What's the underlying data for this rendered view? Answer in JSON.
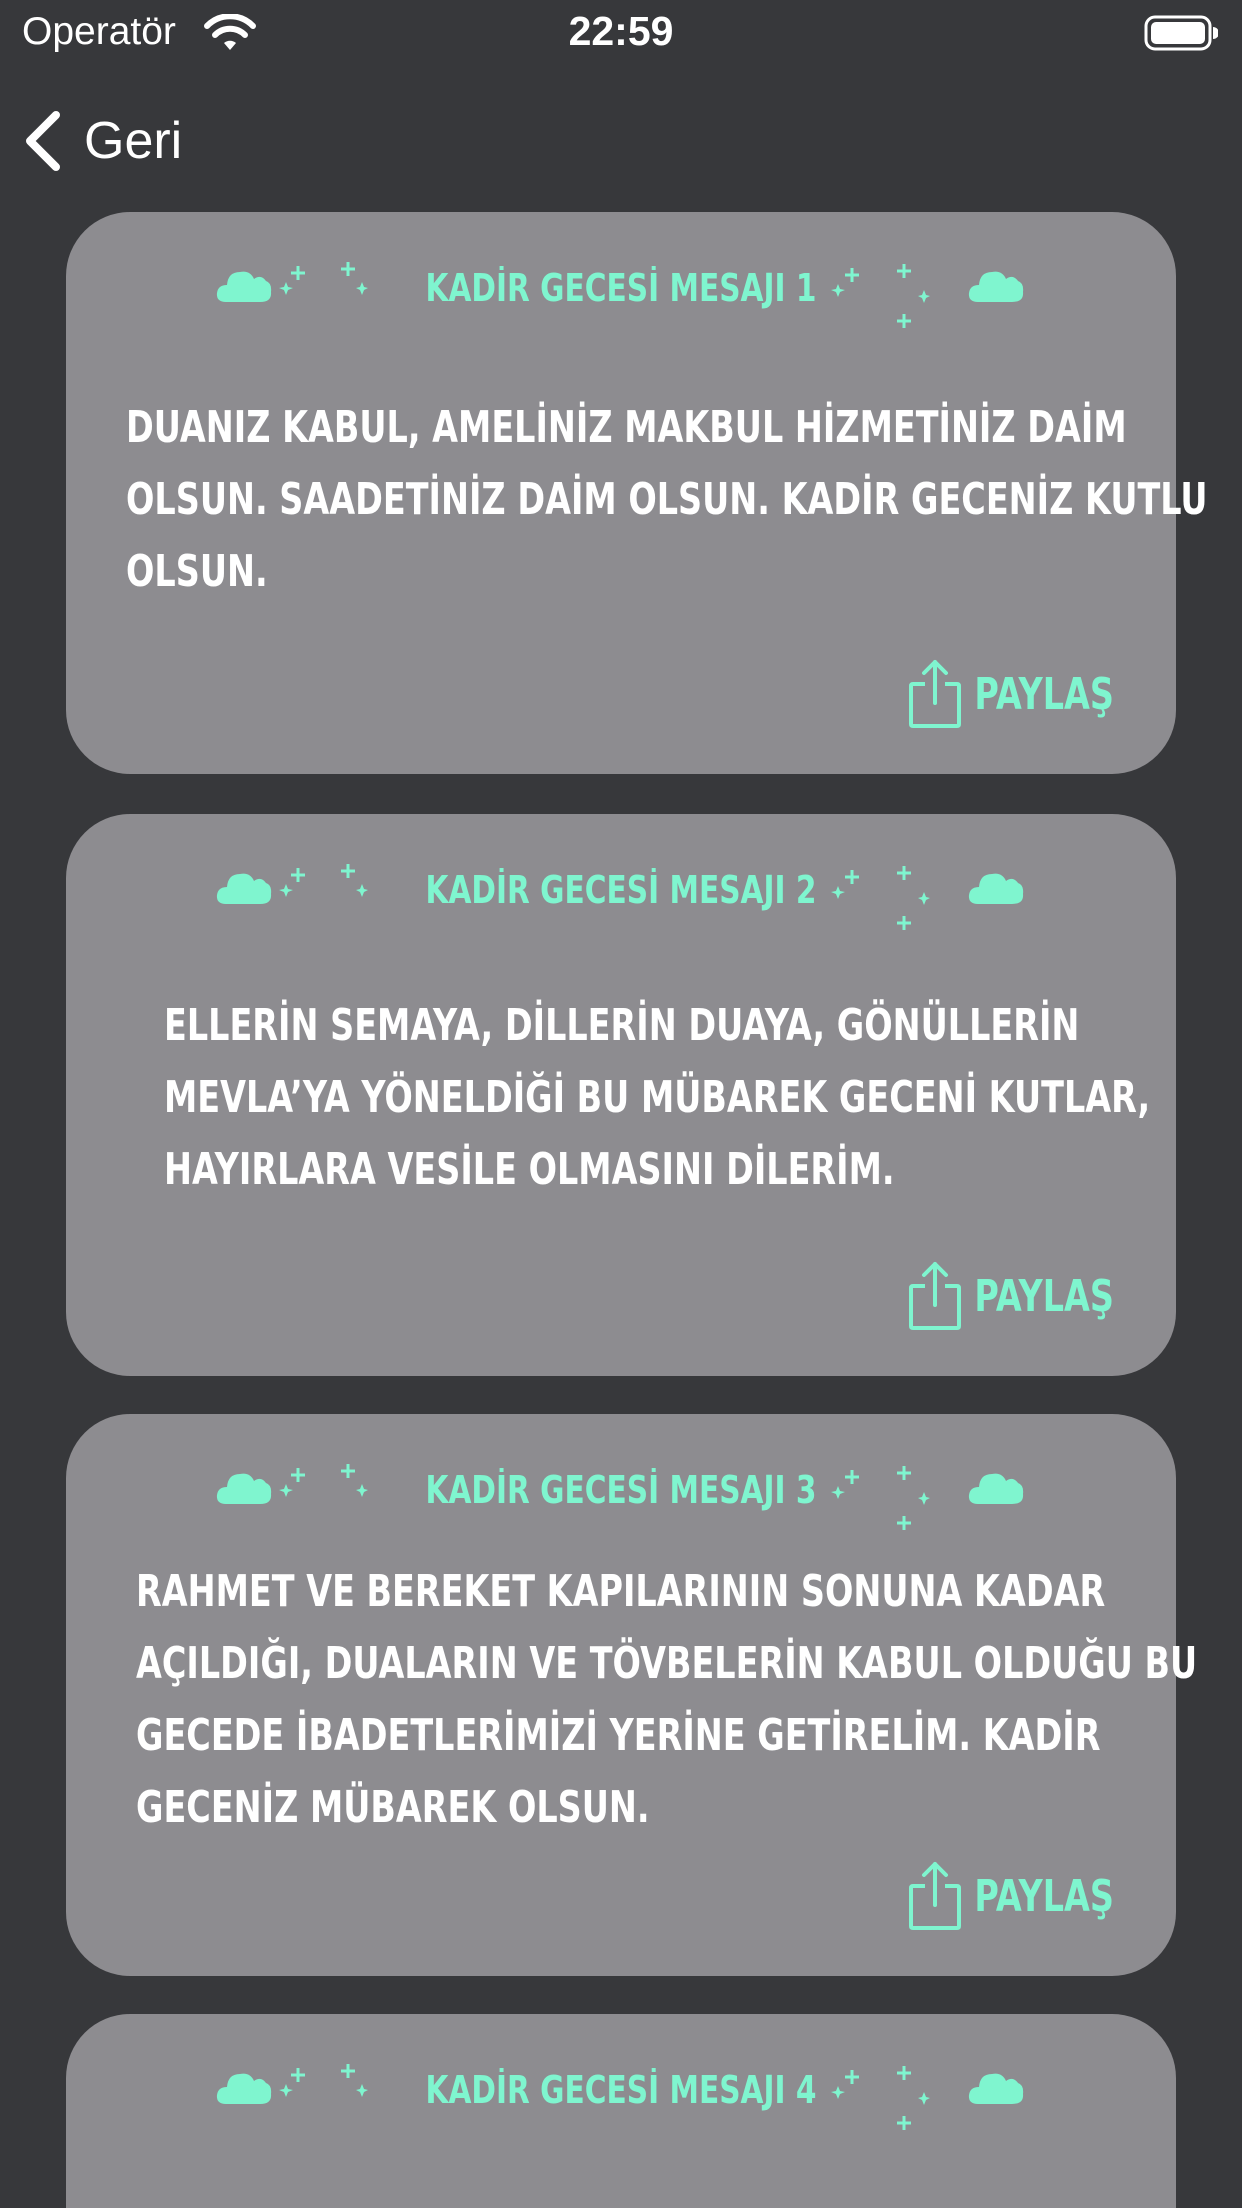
{
  "status_bar": {
    "carrier": "Operatör",
    "time": "22:59"
  },
  "navigation": {
    "back_label": "Geri"
  },
  "icons": {
    "back": "chevron-left-icon",
    "share": "share-icon",
    "wifi": "wifi-icon",
    "battery": "battery-icon",
    "decoration": "cloud-moon-stars-icon"
  },
  "colors": {
    "background": "#37383b",
    "card": "#8d8c90",
    "accent": "#7ff5cf",
    "text": "#ffffff"
  },
  "cards": [
    {
      "title": "KADİR GECESİ MESAJI 1",
      "lines": [
        "DUANIZ KABUL, AMELİNİZ MAKBUL HİZMETİNİZ DAİM",
        "OLSUN. SAADETİNİZ DAİM OLSUN. KADİR GECENİZ KUTLU",
        "OLSUN."
      ],
      "share_label": "PAYLAŞ"
    },
    {
      "title": "KADİR GECESİ MESAJI 2",
      "lines": [
        "ELLERİN SEMAYA, DİLLERİN DUAYA, GÖNÜLLERİN",
        "MEVLA’YA YÖNELDİĞİ BU MÜBAREK GECENİ KUTLAR,",
        "HAYIRLARA VESİLE OLMASINI DİLERİM."
      ],
      "share_label": "PAYLAŞ"
    },
    {
      "title": "KADİR GECESİ MESAJI 3",
      "lines": [
        "RAHMET VE BEREKET KAPILARININ SONUNA KADAR",
        "AÇILDIĞI, DUALARIN VE TÖVBELERİN KABUL OLDUĞU BU",
        "GECEDE İBADETLERİMİZİ YERİNE GETİRELİM. KADİR",
        "GECENİZ MÜBAREK OLSUN."
      ],
      "share_label": "PAYLAŞ"
    },
    {
      "title": "KADİR GECESİ MESAJI 4"
    }
  ]
}
